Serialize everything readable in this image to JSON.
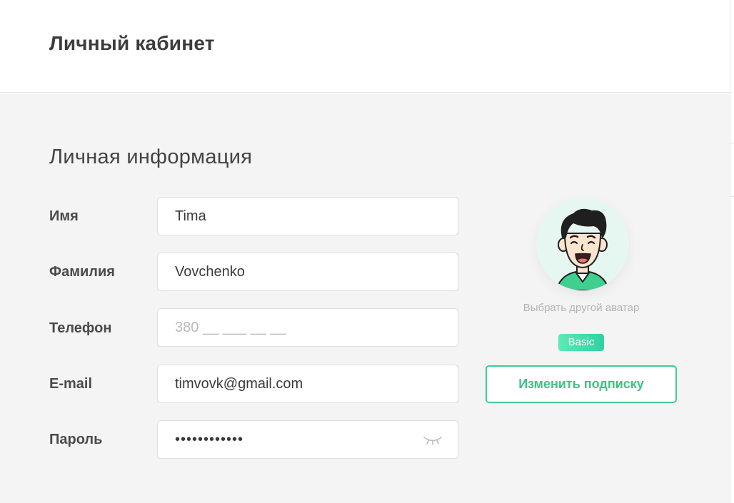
{
  "header": {
    "title": "Личный кабинет"
  },
  "section": {
    "title": "Личная информация"
  },
  "fields": {
    "first_name": {
      "label": "Имя",
      "value": "Tima"
    },
    "last_name": {
      "label": "Фамилия",
      "value": "Vovchenko"
    },
    "phone": {
      "label": "Телефон",
      "value": "",
      "placeholder": "380 __ ___ __ __"
    },
    "email": {
      "label": "E-mail",
      "value": "timvovk@gmail.com"
    },
    "password": {
      "label": "Пароль",
      "masked_value": "••••••••••••",
      "icon": "eye-closed-icon"
    }
  },
  "profile": {
    "avatar_icon": "cartoon-man-avatar",
    "change_avatar_label": "Выбрать другой аватар",
    "plan_badge": "Basic",
    "change_plan_button": "Изменить подписку"
  },
  "colors": {
    "accent": "#3fcf8e",
    "badge_gradient_start": "#5ee9b5",
    "badge_gradient_end": "#2dd2a0",
    "background": "#f4f4f4"
  }
}
